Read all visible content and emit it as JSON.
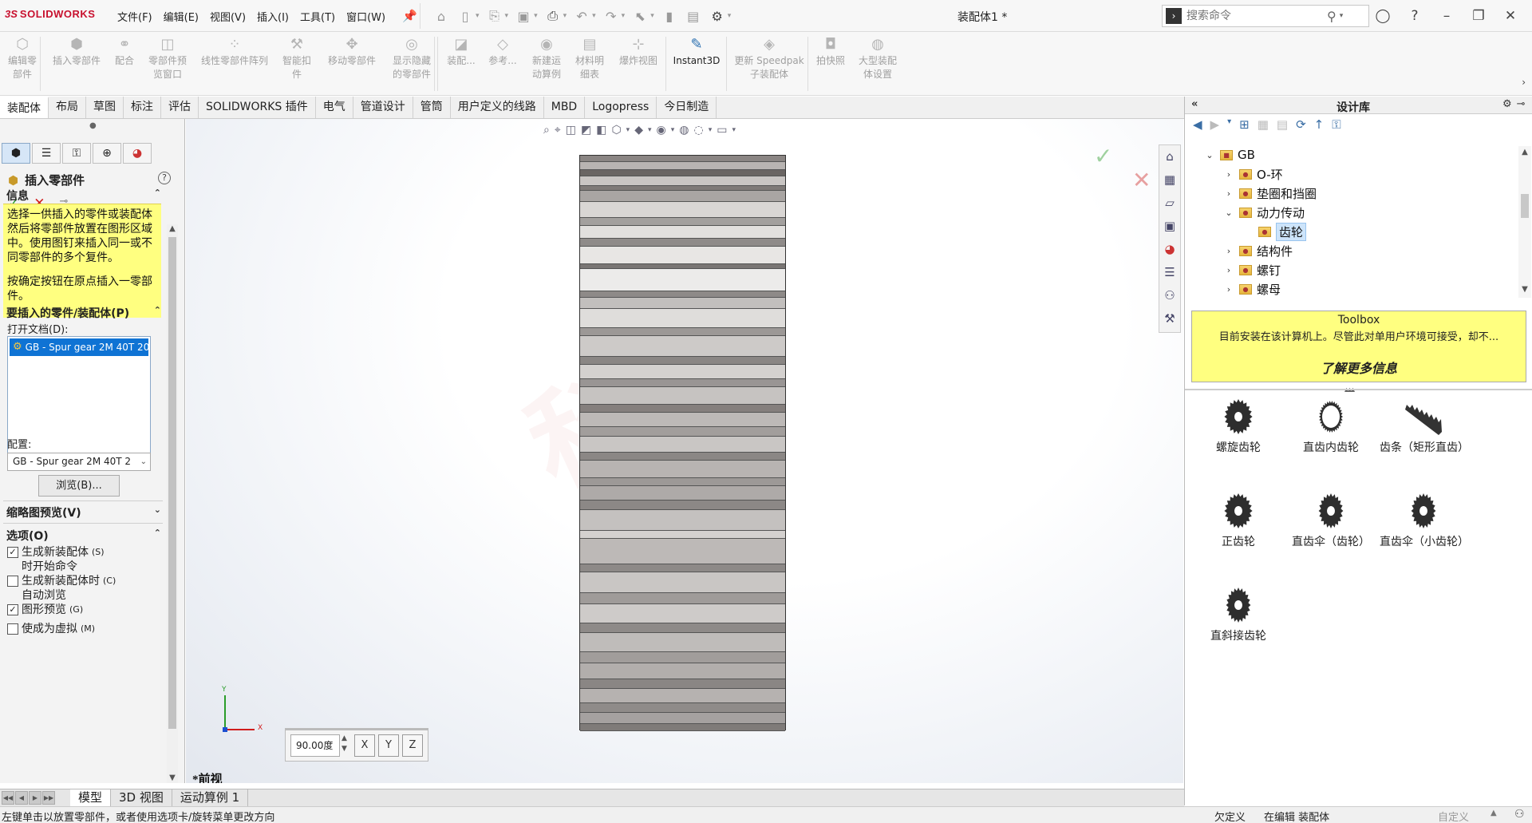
{
  "app": {
    "logo_ds": "3S",
    "logo_name": "SOLIDWORKS",
    "title": "装配体1 *",
    "menus": [
      "文件(F)",
      "编辑(E)",
      "视图(V)",
      "插入(I)",
      "工具(T)",
      "窗口(W)"
    ],
    "search_placeholder": "搜索命令"
  },
  "commands": [
    {
      "label": "编辑零\n部件",
      "icon": "edit-component-icon",
      "active": false
    },
    {
      "label": "插入零部件",
      "icon": "insert-components-icon",
      "active": false
    },
    {
      "label": "配合",
      "icon": "mate-icon",
      "active": false
    },
    {
      "label": "零部件预\n览窗口",
      "icon": "component-preview-icon",
      "active": false
    },
    {
      "label": "线性零部件阵列",
      "icon": "linear-pattern-icon",
      "active": false
    },
    {
      "label": "智能扣\n件",
      "icon": "smart-fasteners-icon",
      "active": false
    },
    {
      "label": "移动零部件",
      "icon": "move-component-icon",
      "active": false
    },
    {
      "label": "显示隐藏\n的零部件",
      "icon": "show-hidden-icon",
      "active": false
    },
    {
      "label": "装配...",
      "icon": "assembly-features-icon",
      "active": false
    },
    {
      "label": "参考...",
      "icon": "reference-geometry-icon",
      "active": false
    },
    {
      "label": "新建运\n动算例",
      "icon": "new-motion-study-icon",
      "active": false
    },
    {
      "label": "材料明\n细表",
      "icon": "bom-icon",
      "active": false
    },
    {
      "label": "爆炸视图",
      "icon": "exploded-view-icon",
      "active": false
    },
    {
      "label": "Instant3D",
      "icon": "instant3d-icon",
      "active": true
    },
    {
      "label": "更新 Speedpak\n子装配体",
      "icon": "speedpak-icon",
      "active": false
    },
    {
      "label": "拍快照",
      "icon": "snapshot-icon",
      "active": false
    },
    {
      "label": "大型装配\n体设置",
      "icon": "large-assembly-icon",
      "active": false
    }
  ],
  "tabs": [
    "装配体",
    "布局",
    "草图",
    "标注",
    "评估",
    "SOLIDWORKS 插件",
    "电气",
    "管道设计",
    "管筒",
    "用户定义的线路",
    "MBD",
    "Logopress",
    "今日制造"
  ],
  "property_manager": {
    "title": "插入零部件",
    "help": "?",
    "info_title": "信息",
    "info_p1": "选择一供插入的零件或装配体然后将零部件放置在图形区域中。使用图钉来插入同一或不同零部件的多个复件。",
    "info_p2": "按确定按钮在原点插入一零部件。",
    "part_section_title": "要插入的零件/装配体(P)",
    "open_docs_label": "打开文档(D):",
    "open_doc_item": "GB - Spur gear 2M 40T 20",
    "config_label": "配置:",
    "config_value": "GB - Spur gear 2M 40T 2",
    "browse_label": "浏览(B)...",
    "thumbnail_title": "缩略图预览(V)",
    "options_title": "选项(O)",
    "options": [
      {
        "label": "生成新装配体\n时开始命令",
        "shortcut": "(S)",
        "checked": true
      },
      {
        "label": "生成新装配体时\n自动浏览",
        "shortcut": "(C)",
        "checked": false
      },
      {
        "label": "图形预览",
        "shortcut": "(G)",
        "checked": true
      },
      {
        "label": "使成为虚拟",
        "shortcut": "(M)",
        "checked": false
      }
    ]
  },
  "graphics": {
    "rotation_value": "90.00度",
    "view_name": "*前视",
    "watermark": "科技"
  },
  "bottom_tabs": [
    "模型",
    "3D 视图",
    "运动算例 1"
  ],
  "status": {
    "hint": "左键单击以放置零部件，或者使用选项卡/旋转菜单更改方向",
    "state": "欠定义",
    "editing": "在编辑 装配体",
    "units": "自定义",
    "units_arrow": "▲"
  },
  "design_library": {
    "title": "设计库",
    "tree": [
      {
        "label": "GB",
        "level": 0,
        "expanded": true,
        "selected": false
      },
      {
        "label": "O-环",
        "level": 1,
        "expanded": false,
        "selected": false
      },
      {
        "label": "垫圈和挡圈",
        "level": 1,
        "expanded": false,
        "selected": false
      },
      {
        "label": "动力传动",
        "level": 1,
        "expanded": true,
        "selected": false
      },
      {
        "label": "齿轮",
        "level": 2,
        "expanded": false,
        "selected": true
      },
      {
        "label": "结构件",
        "level": 1,
        "expanded": false,
        "selected": false
      },
      {
        "label": "螺钉",
        "level": 1,
        "expanded": false,
        "selected": false
      },
      {
        "label": "螺母",
        "level": 1,
        "expanded": false,
        "selected": false
      }
    ],
    "toolbox_title": "Toolbox",
    "toolbox_text": "目前安装在该计算机上。尽管此对单用户环境可接受，却不...",
    "toolbox_link": "了解更多信息",
    "items": [
      {
        "label": "螺旋齿轮",
        "shape": "helical"
      },
      {
        "label": "直齿内齿轮",
        "shape": "internal"
      },
      {
        "label": "齿条（矩形直齿）",
        "shape": "rack"
      },
      {
        "label": "正齿轮",
        "shape": "spur"
      },
      {
        "label": "直齿伞（齿轮）",
        "shape": "bevel"
      },
      {
        "label": "直齿伞（小齿轮）",
        "shape": "bevel2"
      },
      {
        "label": "直斜接齿轮",
        "shape": "miter"
      }
    ]
  },
  "colors": {
    "accent_selected": "#0f73d4",
    "info_yellow": "#ffff80",
    "ok_green": "#2a9d2a",
    "cancel_red": "#d01c1c"
  }
}
